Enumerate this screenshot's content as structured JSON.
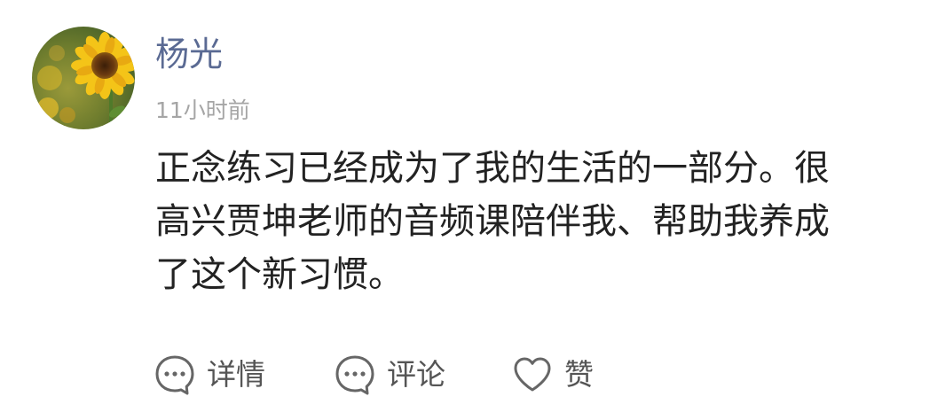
{
  "post": {
    "author": {
      "name": "杨光",
      "avatar_icon": "sunflower-avatar"
    },
    "time": "11小时前",
    "content": {
      "lines": [
        "正念练习已经成为了我的生活的一部分。很",
        "高兴贾坤老师的音频课陪伴我、帮助我养成",
        "了这个新习惯。"
      ]
    },
    "actions": {
      "details": {
        "label": "详情",
        "icon": "chat-bubble-icon"
      },
      "comment": {
        "label": "评论",
        "icon": "chat-bubble-icon"
      },
      "like": {
        "label": "赞",
        "icon": "heart-icon"
      }
    }
  },
  "colors": {
    "username": "#5a6a93",
    "timestamp": "#a5a5a5",
    "body_text": "#222222",
    "action_text": "#555555",
    "icon_stroke": "#666666"
  }
}
